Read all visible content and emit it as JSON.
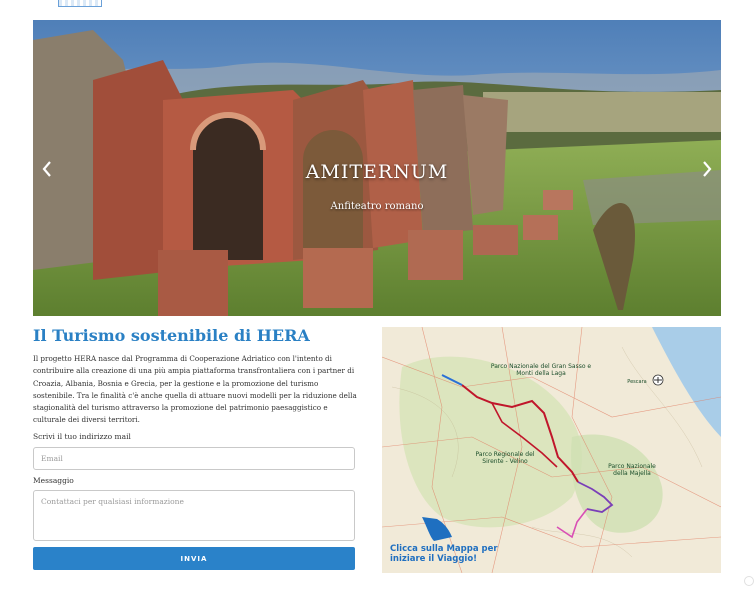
{
  "hero": {
    "title": "AMITERNUM",
    "subtitle": "Anfiteatro romano",
    "prev_icon": "chevron-left-icon",
    "next_icon": "chevron-right-icon"
  },
  "intro": {
    "title": "Il Turismo sostenibile di HERA",
    "text": "Il progetto HERA nasce dal Programma di Cooperazione Adriatico con l'intento di contribuire alla creazione di una più ampia piattaforma transfrontaliera con i partner di Croazia, Albania, Bosnia e Grecia, per la gestione e la promozione del turismo sostenibile. Tra le finalità c'è anche quella di attuare nuovi modelli per la riduzione della stagionalità del turismo attraverso la promozione del patrimonio paesaggistico e culturale dei diversi territori."
  },
  "form": {
    "email_label": "Scrivi il tuo indirizzo mail",
    "email_placeholder": "Email",
    "message_label": "Messaggio",
    "message_placeholder": "Contattaci per qualsiasi informazione",
    "submit_label": "INVIA"
  },
  "map": {
    "labels": {
      "gran_sasso": "Parco Nazionale del Gran Sasso e Monti della Laga",
      "sirente": "Parco Regionale del Sirente - Velino",
      "majella": "Parco Nazionale della Majella",
      "pescara": "Pescara"
    },
    "cta": "Clicca sulla Mappa per iniziare il Viaggio!",
    "hand_icon": "pointing-hand-icon",
    "airport_icon": "airplane-icon",
    "colors": {
      "route_red": "#c0162b",
      "route_blue": "#2a6fd6",
      "route_purple": "#7a3fb8",
      "route_pink": "#d94fb5"
    }
  },
  "colors": {
    "accent": "#2a80c4",
    "button": "#2a82c9"
  }
}
